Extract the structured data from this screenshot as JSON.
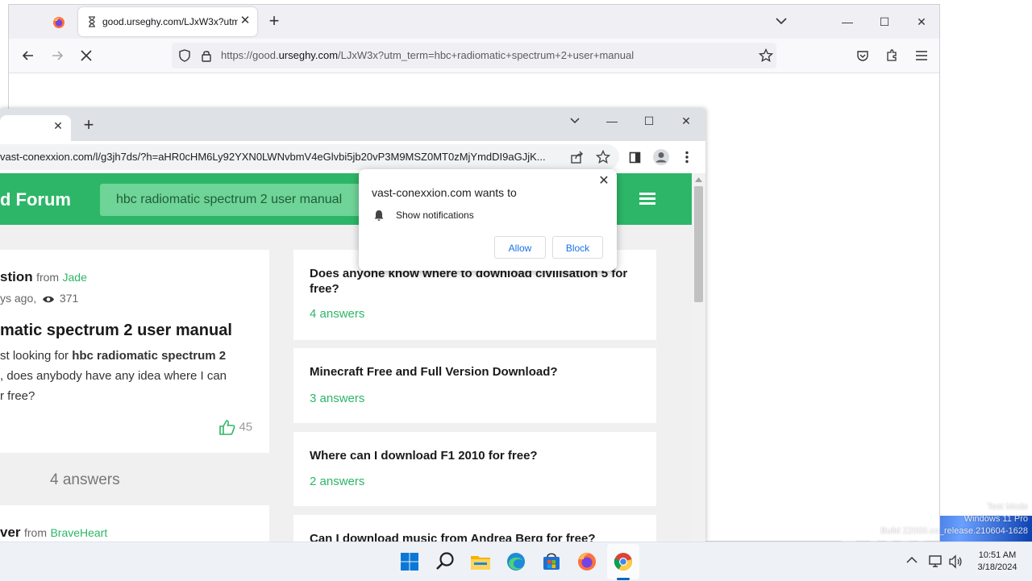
{
  "desktop": {
    "watermark": "ANY RUN",
    "test_mode_lines": [
      "Test Mode",
      "Windows 11 Pro",
      "Build 22000.co_release.210604-1628"
    ]
  },
  "firefox": {
    "tab_title": "good.urseghy.com/LJxW3x?utm_term=hbc+radiomatic+spectrum+2+user+manual",
    "url_prefix": "https://good.",
    "url_domain": "urseghy.com",
    "url_path": "/LJxW3x?utm_term=hbc+radiomatic+spectrum+2+user+manual"
  },
  "chrome": {
    "url": "vast-conexxion.com/l/g3jh7ds/?h=aHR0cHM6Ly92YXN0LWNvbmV4eGlvbi5jb20vP3M9MSZ0MT0zMjYmdDI9aGJjK..."
  },
  "site": {
    "logo": "d Forum",
    "search_query": "hbc radiomatic spectrum 2 user manual",
    "post": {
      "heading_fragment": "stion",
      "from_label": "from",
      "author": "Jade",
      "age": "ys ago,",
      "views": "371",
      "title": "matic spectrum 2 user manual",
      "body_line1_prefix": "st looking for ",
      "body_line1_bold": "hbc radiomatic spectrum 2",
      "body_line2": ", does anybody have any idea where I can",
      "body_line3": "r free?",
      "likes": "45"
    },
    "answers_count": "4 answers",
    "answer_card": {
      "heading_fragment": "ver",
      "from_label": "from",
      "author": "BraveHeart"
    },
    "related": [
      {
        "title": "Does anyone know where to download civilisation 5 for free?",
        "answers": "4 answers"
      },
      {
        "title": "Minecraft Free and Full Version Download?",
        "answers": "3 answers"
      },
      {
        "title": "Where can I download F1 2010 for free?",
        "answers": "2 answers"
      },
      {
        "title": "Can I download music from Andrea Berg for free?",
        "answers": ""
      }
    ]
  },
  "notification": {
    "title": "vast-conexxion.com wants to",
    "permission": "Show notifications",
    "allow": "Allow",
    "block": "Block"
  },
  "taskbar": {
    "time": "10:51 AM",
    "date": "3/18/2024"
  }
}
